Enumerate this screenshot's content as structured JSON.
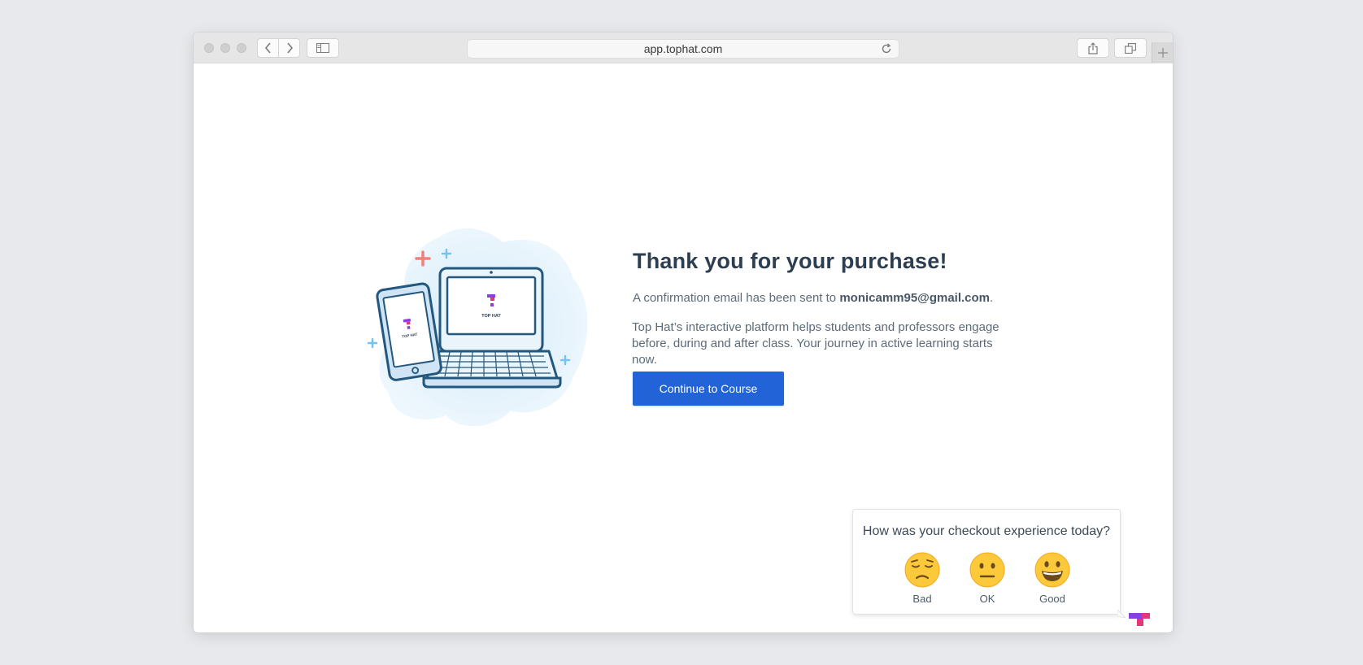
{
  "browser": {
    "url": "app.tophat.com",
    "icons": [
      "traffic-light-close",
      "traffic-light-minimize",
      "traffic-light-zoom",
      "chevron-left-icon",
      "chevron-right-icon",
      "sidebar-icon",
      "reload-icon",
      "share-icon",
      "tabs-icon",
      "plus-icon"
    ]
  },
  "illustration": {
    "screen_brand": "TOP HAT",
    "phone_brand": "TOP HAT"
  },
  "main": {
    "title": "Thank you for your purchase!",
    "confirm_prefix": "A confirmation email has been sent to ",
    "email": "monicamm95@gmail.com",
    "confirm_suffix": ".",
    "description": "Top Hat’s interactive platform helps students and professors engage before, during and after class. Your journey in active learning starts now.",
    "continue_label": "Continue to Course"
  },
  "feedback": {
    "question": "How was your checkout experience today?",
    "options": [
      {
        "label": "Bad",
        "icon": "pensive-face-icon"
      },
      {
        "label": "OK",
        "icon": "neutral-face-icon"
      },
      {
        "label": "Good",
        "icon": "grinning-face-icon"
      }
    ]
  },
  "colors": {
    "accent": "#2264d8",
    "title": "#2d3e50",
    "brand_pink": "#e5357d",
    "brand_purple": "#8a3fe0"
  }
}
